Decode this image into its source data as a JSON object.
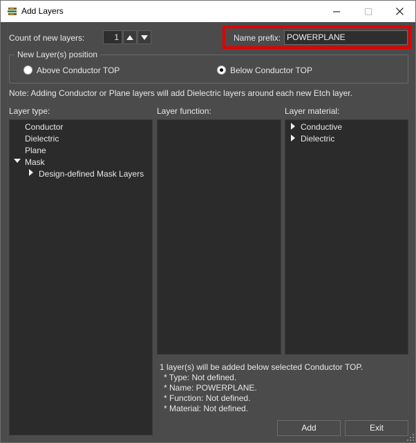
{
  "window": {
    "title": "Add Layers",
    "icons": {
      "app": "layers-app-icon",
      "minimize": "minimize-icon",
      "maximize": "maximize-icon",
      "close": "close-icon"
    }
  },
  "count": {
    "label": "Count of new layers:",
    "value": "1"
  },
  "prefix": {
    "label": "Name prefix:",
    "value": "POWERPLANE",
    "highlight_color": "#e00000"
  },
  "position": {
    "group_label": "New Layer(s) position",
    "options": [
      {
        "label": "Above Conductor TOP",
        "checked": false
      },
      {
        "label": "Below Conductor TOP",
        "checked": true
      }
    ]
  },
  "note": "Note: Adding Conductor or Plane layers will add Dielectric layers around each new Etch layer.",
  "layer_type": {
    "header": "Layer type:",
    "items": [
      {
        "label": "Conductor",
        "expander": "none"
      },
      {
        "label": "Dielectric",
        "expander": "none"
      },
      {
        "label": "Plane",
        "expander": "none"
      },
      {
        "label": "Mask",
        "expander": "expanded"
      },
      {
        "label": "Design-defined Mask Layers",
        "expander": "collapsed"
      }
    ]
  },
  "layer_function": {
    "header": "Layer function:",
    "items": []
  },
  "layer_material": {
    "header": "Layer material:",
    "items": [
      {
        "label": "Conductive",
        "expander": "collapsed"
      },
      {
        "label": "Dielectric",
        "expander": "collapsed"
      }
    ]
  },
  "summary": {
    "line1": "1 layer(s) will be added below selected Conductor TOP.",
    "line2": "* Type: Not defined.",
    "line3": "* Name: POWERPLANE.",
    "line4": "* Function: Not defined.",
    "line5": "* Material: Not defined."
  },
  "buttons": {
    "add": "Add",
    "exit": "Exit"
  },
  "colors": {
    "background": "#4b4b4b",
    "panel": "#2b2b2b",
    "titlebar": "#ffffff"
  }
}
